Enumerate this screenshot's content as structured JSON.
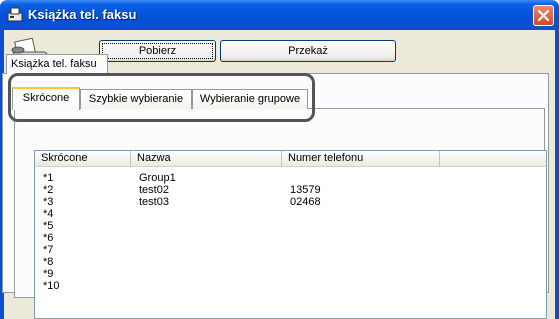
{
  "window": {
    "title": "Książka tel. faksu"
  },
  "toolbar": {
    "pobierz_label": "Pobierz",
    "przekaz_label": "Przekaż"
  },
  "outer_tab": {
    "label": "Książka tel. faksu"
  },
  "inner_tabs": [
    {
      "label": "Skrócone"
    },
    {
      "label": "Szybkie wybieranie"
    },
    {
      "label": "Wybieranie grupowe"
    }
  ],
  "table": {
    "columns": [
      "Skrócone",
      "Nazwa",
      "Numer telefonu"
    ],
    "rows": [
      {
        "code": "*1",
        "name": "Group1",
        "phone": ""
      },
      {
        "code": "*2",
        "name": "test02",
        "phone": "13579"
      },
      {
        "code": "*3",
        "name": "test03",
        "phone": "02468"
      },
      {
        "code": "*4",
        "name": "",
        "phone": ""
      },
      {
        "code": "*5",
        "name": "",
        "phone": ""
      },
      {
        "code": "*6",
        "name": "",
        "phone": ""
      },
      {
        "code": "*7",
        "name": "",
        "phone": ""
      },
      {
        "code": "*8",
        "name": "",
        "phone": ""
      },
      {
        "code": "*9",
        "name": "",
        "phone": ""
      },
      {
        "code": "*10",
        "name": "",
        "phone": ""
      }
    ]
  },
  "colors": {
    "titlebar": "#0450d6",
    "dialog_bg": "#ece9d8",
    "active_tab_accent": "#ffc83c",
    "close_button": "#d04a22"
  },
  "icons": {
    "title": "fax-book-icon",
    "close": "close-icon",
    "app": "fax-machine-icon"
  }
}
